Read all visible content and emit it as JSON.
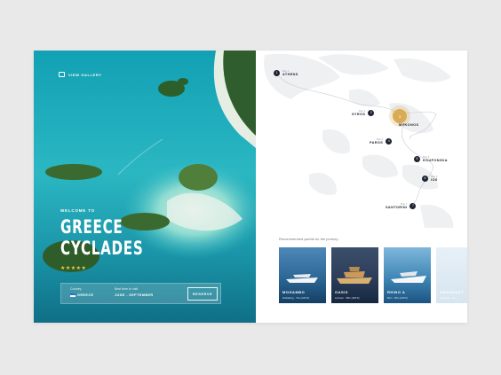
{
  "hero": {
    "gallery_label": "VIEW GALLERY",
    "welcome": "WELCOME TO",
    "title_line1": "GREECE",
    "title_line2": "CYCLADES",
    "stars": "★★★★★",
    "country_label": "Country",
    "country_value": "GREECE",
    "season_label": "Best time to visit",
    "season_value": "JUNE - SEPTEMBER",
    "reserve_label": "RESERVE"
  },
  "route": {
    "stops": [
      {
        "num": "1",
        "day": "Day 1",
        "port": "ATHENS"
      },
      {
        "num": "2",
        "day": "Day 2",
        "port": "SYROS"
      },
      {
        "num": "3",
        "day": "Day 3",
        "port": "MYKONOS"
      },
      {
        "num": "4",
        "day": "Day 4",
        "port": "PAROS"
      },
      {
        "num": "5",
        "day": "Day 5",
        "port": "KOUFONISIA"
      },
      {
        "num": "6",
        "day": "Day 6",
        "port": "IOS"
      },
      {
        "num": "7",
        "day": "Day 7",
        "port": "SANTORINI"
      }
    ]
  },
  "recommendations": {
    "heading": "Recommended yachts for the journey",
    "cards": [
      {
        "name": "MOGAMBO",
        "meta": "Nobiskrug · 74m (243 ft)"
      },
      {
        "name": "OASIS",
        "meta": "Lürssen · 58m (190 ft)"
      },
      {
        "name": "RHINO A",
        "meta": "Mon · 35m (115 ft)"
      },
      {
        "name": "ARGONAUT",
        "meta": "Feadship · 57m"
      }
    ]
  },
  "colors": {
    "accent": "#d9ab55",
    "sea": "#29a8b8",
    "dark": "#1d2330"
  }
}
